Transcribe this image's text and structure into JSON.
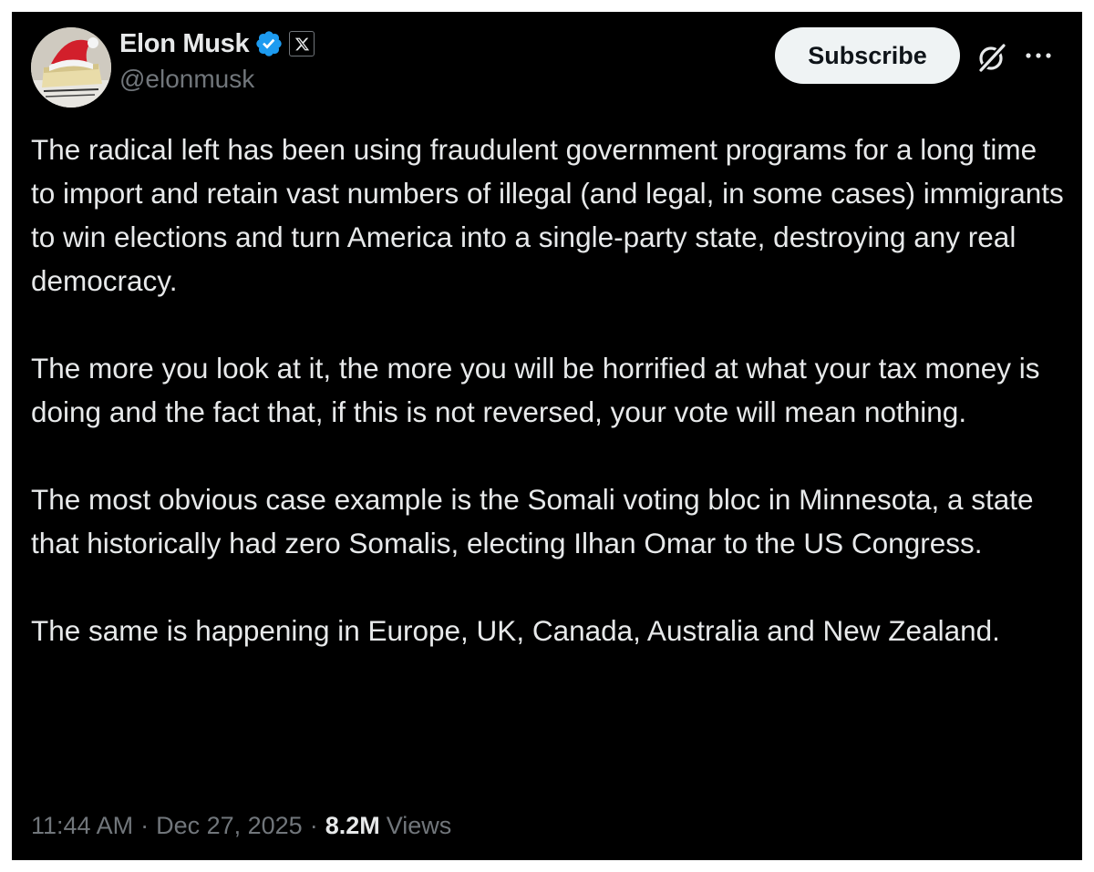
{
  "author": {
    "display_name": "Elon Musk",
    "handle": "@elonmusk",
    "verified_icon": "verified-badge-icon",
    "affiliate_icon": "x-logo-icon",
    "colors": {
      "verified": "#1d9bf0",
      "name": "#e7e9ea",
      "secondary": "#71767b"
    }
  },
  "actions": {
    "subscribe_label": "Subscribe",
    "grok_icon": "grok-icon",
    "more_icon": "more-icon"
  },
  "post": {
    "paragraphs": [
      "The radical left has been using fraudulent government programs for a long time to import and retain vast numbers of illegal (and legal, in some cases) immigrants to win elections and turn America into a single-party state, destroying any real democracy.",
      "The more you look at it, the more you will be horrified at what your tax money is doing and the fact that, if this is not reversed, your vote will mean nothing.",
      "The most obvious case example is the Somali voting bloc in Minnesota, a state that historically had zero Somalis, electing Ilhan Omar to the US Congress.",
      "The same is happening in Europe, UK, Canada, Australia and New Zealand."
    ]
  },
  "meta": {
    "time": "11:44 AM",
    "separator": "·",
    "date": "Dec 27, 2025",
    "views_count": "8.2M",
    "views_label": "Views"
  },
  "theme": {
    "background": "#000000",
    "text": "#e7e9ea",
    "button_bg": "#eff3f4",
    "button_text": "#0f1419"
  }
}
